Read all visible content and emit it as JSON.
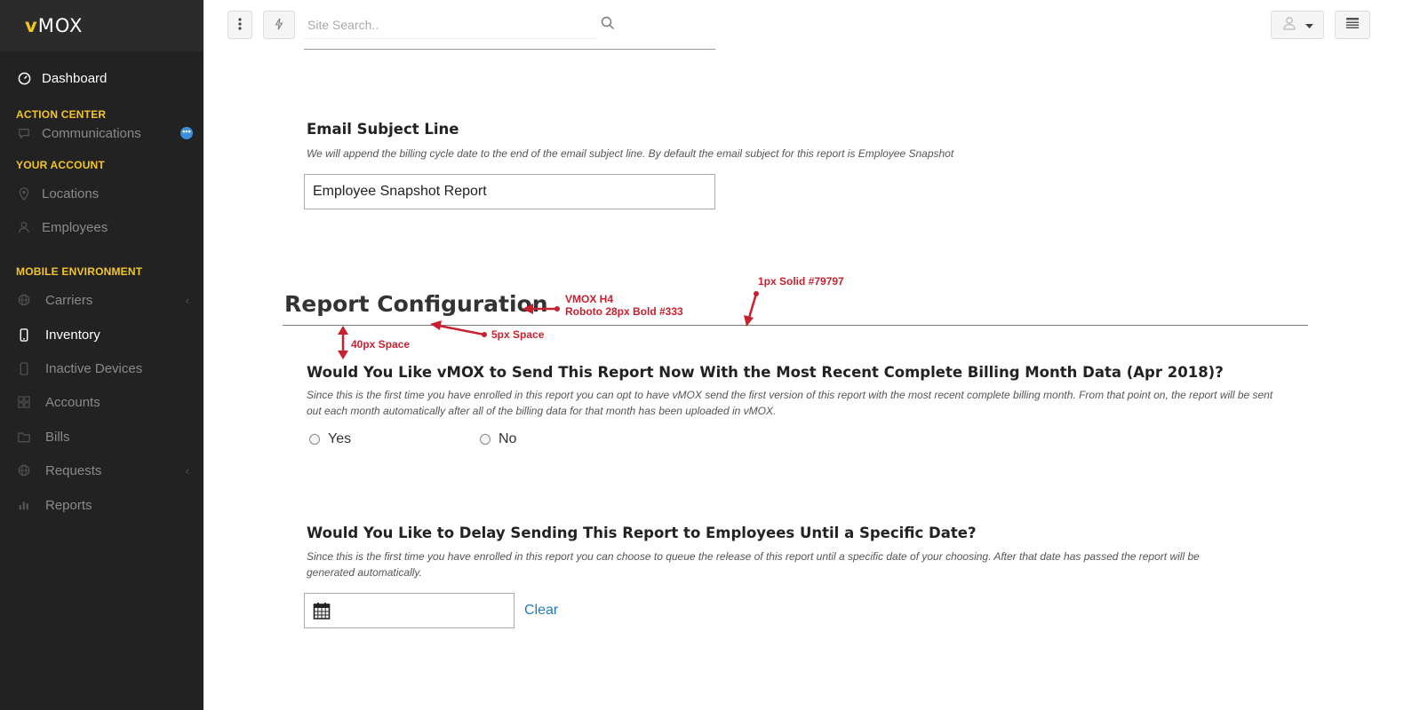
{
  "brand": {
    "logo_prefix": "v",
    "logo_text": "MOX"
  },
  "sidebar": {
    "dashboard": "Dashboard",
    "action_center": "ACTION CENTER",
    "communications": "Communications",
    "communications_badge": "•••",
    "your_account": "YOUR ACCOUNT",
    "locations": "Locations",
    "employees": "Employees",
    "mobile_environment": "MOBILE ENVIRONMENT",
    "carriers": "Carriers",
    "inventory": "Inventory",
    "inactive_devices": "Inactive Devices",
    "accounts": "Accounts",
    "bills": "Bills",
    "requests": "Requests",
    "reports": "Reports"
  },
  "topbar": {
    "search_placeholder": "Site Search.."
  },
  "email_subject": {
    "title": "Email Subject Line",
    "help": "We will append the   billing cycle date to the end of the email subject line.  By default the email subject for this report is Employee Snapshot",
    "value": "Employee Snapshot Report"
  },
  "report_config": {
    "title": "Report Configuration"
  },
  "send_now": {
    "question": "Would You Like vMOX to Send This Report Now With the Most Recent Complete Billing Month Data (Apr 2018)?",
    "help_line1": "Since this is the first time you have enrolled in this report you can opt to have vMOX send the first version of this report with the most recent complete billing month.  From that point on, the report will be sent",
    "help_line2": "out each month automatically after all of the billing data for that month has been uploaded in vMOX.",
    "yes": "Yes",
    "no": "No"
  },
  "delay": {
    "question": "Would You Like to Delay Sending This Report to Employees Until a Specific Date?",
    "help_line1": "Since this is the first time you have enrolled in this report you can choose to queue the release of this report until a specific date of your choosing.  After that date has passed the report will be",
    "help_line2": "generated automatically.",
    "date_value": "",
    "clear": "Clear"
  },
  "annotations": {
    "h4_line1": "VMOX H4",
    "h4_line2": "Roboto 28px Bold #333",
    "rule_note": "1px Solid #79797",
    "space_40": "40px Space",
    "space_5": "5px Space"
  },
  "colors": {
    "sidebar_bg": "#222222",
    "accent_yellow": "#f3c623",
    "link_blue": "#1f7bb8",
    "annotation_red": "#c8202f",
    "rule": "#797979"
  }
}
